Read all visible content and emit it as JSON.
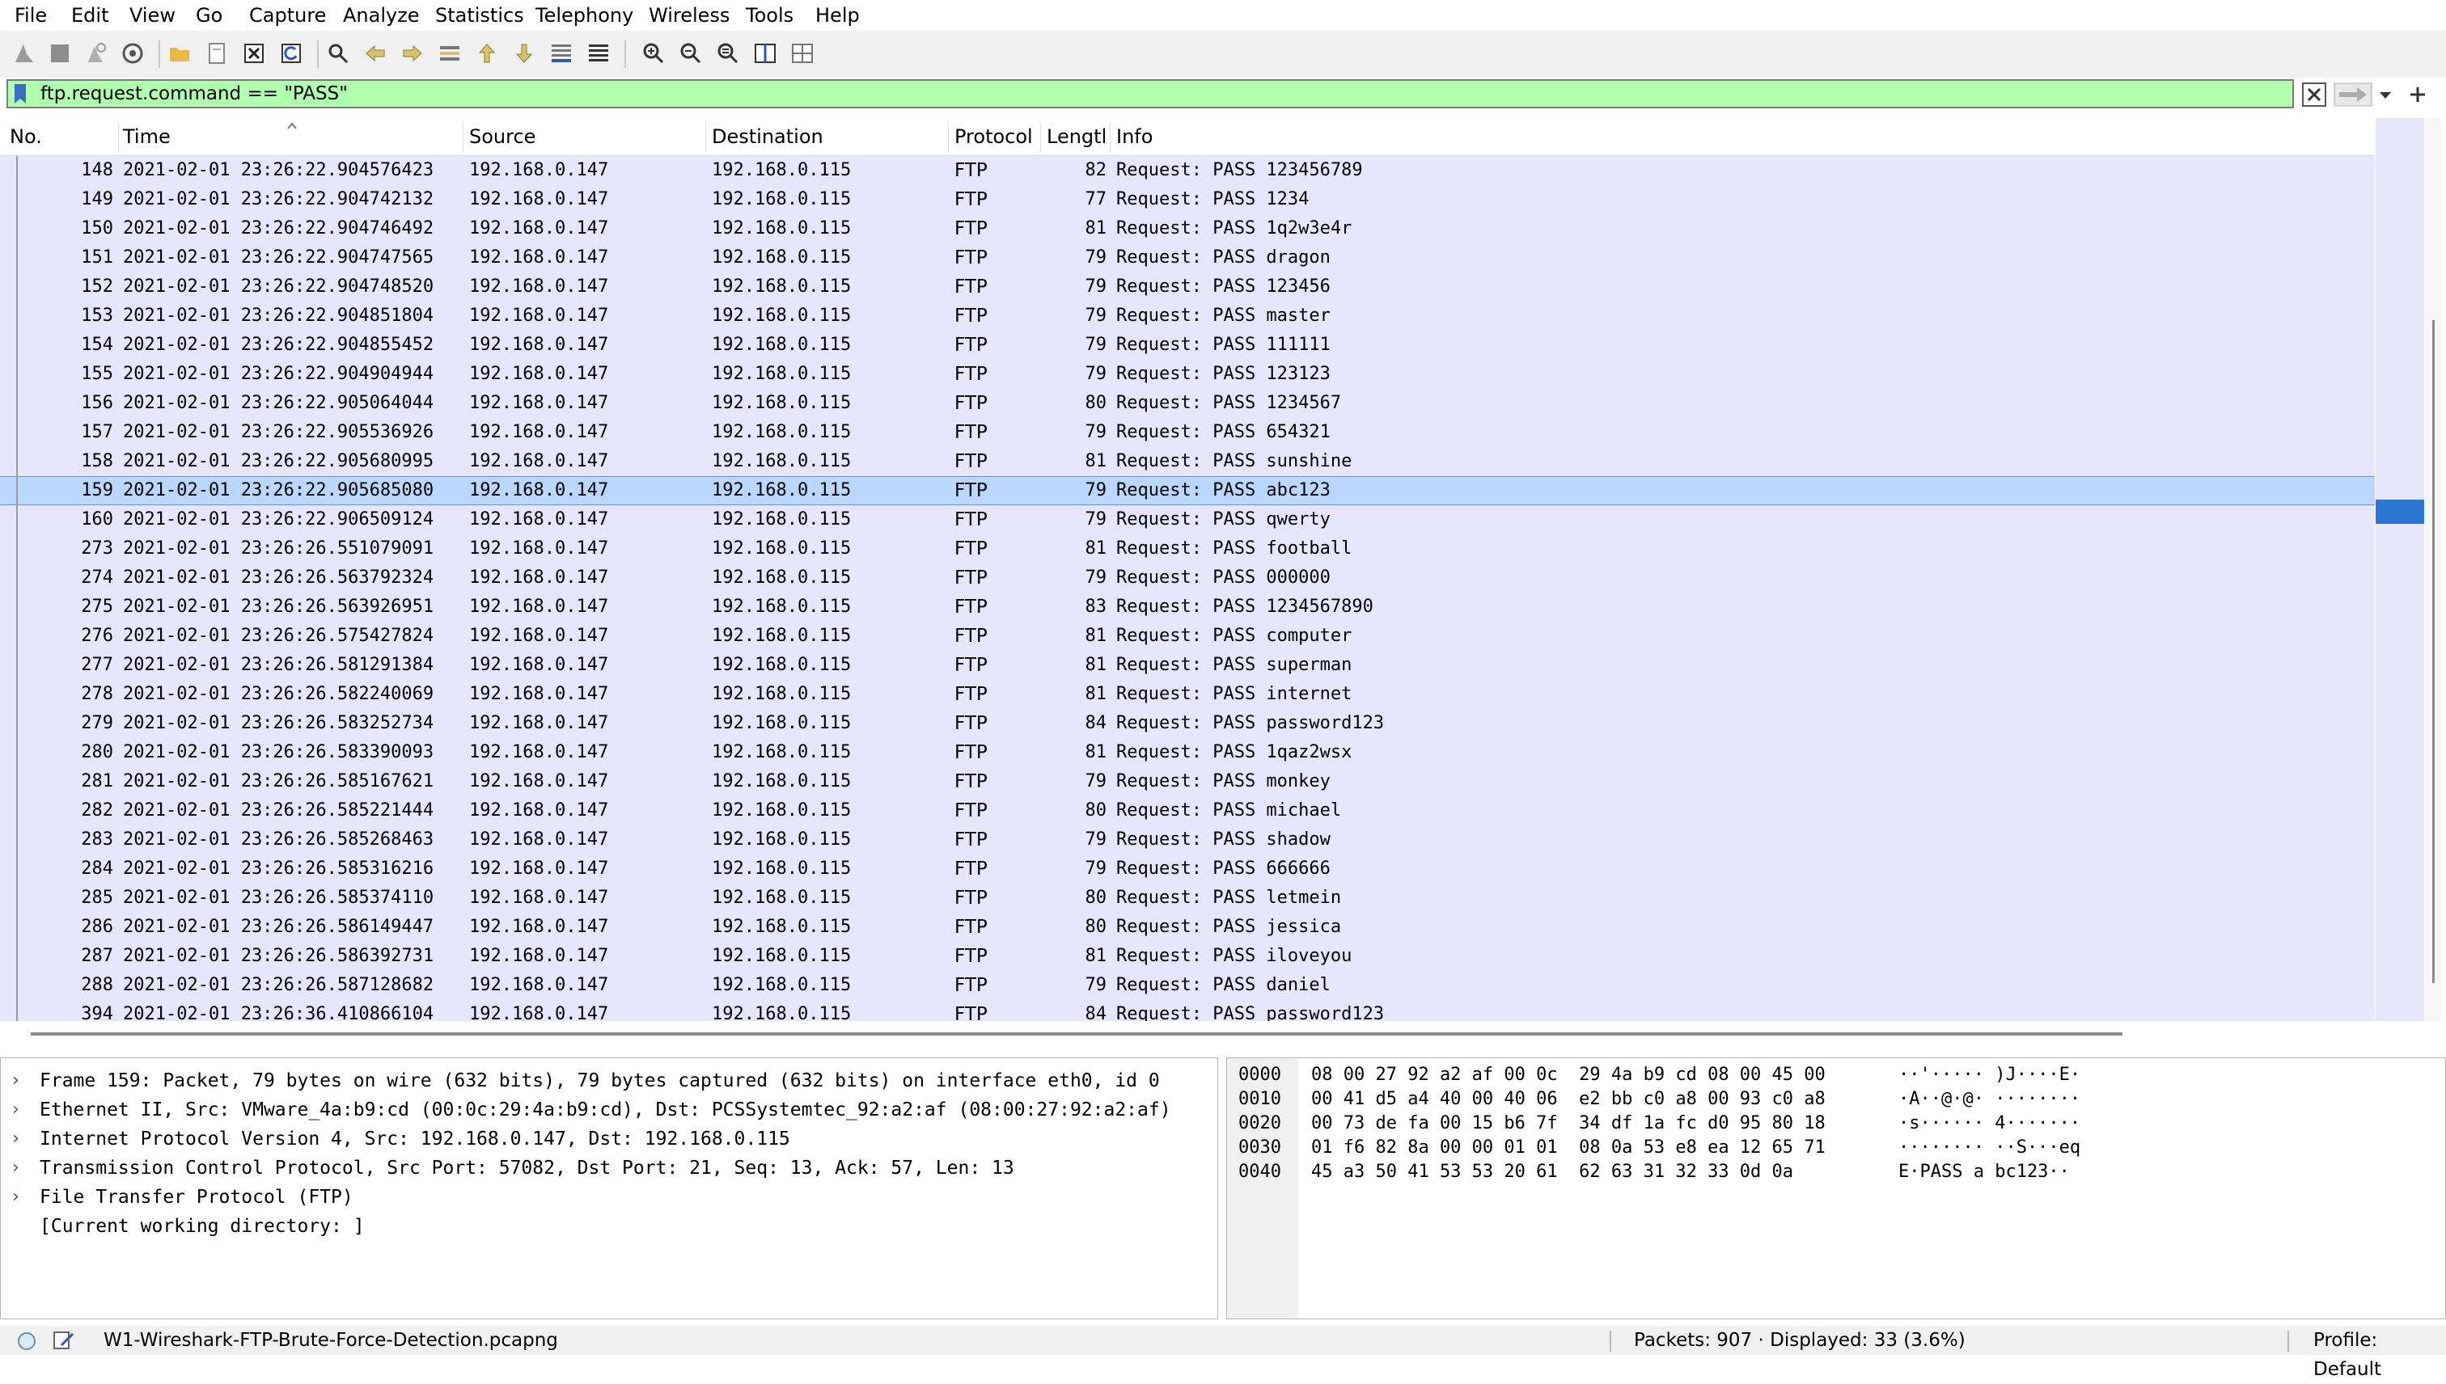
{
  "menu": [
    "File",
    "Edit",
    "View",
    "Go",
    "Capture",
    "Analyze",
    "Statistics",
    "Telephony",
    "Wireless",
    "Tools",
    "Help"
  ],
  "toolbar_icons": [
    "shark-fin-start-icon",
    "stop-capture-icon",
    "restart-capture-icon",
    "capture-options-icon",
    "open-file-icon",
    "save-file-icon",
    "close-file-icon",
    "reload-file-icon",
    "find-packet-icon",
    "go-back-icon",
    "go-forward-icon",
    "go-to-packet-icon",
    "go-first-icon",
    "go-last-icon",
    "auto-scroll-icon",
    "colorize-icon",
    "zoom-in-icon",
    "zoom-out-icon",
    "normal-size-icon",
    "resize-columns-icon",
    "layout-icon"
  ],
  "filter": {
    "value": "ftp.request.command == \"PASS\""
  },
  "columns": [
    "No.",
    "Time",
    "Source",
    "Destination",
    "Protocol",
    "Lengtl",
    "Info"
  ],
  "packets": [
    {
      "no": "148",
      "time": "2021-02-01 23:26:22.904576423",
      "src": "192.168.0.147",
      "dst": "192.168.0.115",
      "proto": "FTP",
      "len": "82",
      "info": "Request: PASS 123456789"
    },
    {
      "no": "149",
      "time": "2021-02-01 23:26:22.904742132",
      "src": "192.168.0.147",
      "dst": "192.168.0.115",
      "proto": "FTP",
      "len": "77",
      "info": "Request: PASS 1234"
    },
    {
      "no": "150",
      "time": "2021-02-01 23:26:22.904746492",
      "src": "192.168.0.147",
      "dst": "192.168.0.115",
      "proto": "FTP",
      "len": "81",
      "info": "Request: PASS 1q2w3e4r"
    },
    {
      "no": "151",
      "time": "2021-02-01 23:26:22.904747565",
      "src": "192.168.0.147",
      "dst": "192.168.0.115",
      "proto": "FTP",
      "len": "79",
      "info": "Request: PASS dragon"
    },
    {
      "no": "152",
      "time": "2021-02-01 23:26:22.904748520",
      "src": "192.168.0.147",
      "dst": "192.168.0.115",
      "proto": "FTP",
      "len": "79",
      "info": "Request: PASS 123456"
    },
    {
      "no": "153",
      "time": "2021-02-01 23:26:22.904851804",
      "src": "192.168.0.147",
      "dst": "192.168.0.115",
      "proto": "FTP",
      "len": "79",
      "info": "Request: PASS master"
    },
    {
      "no": "154",
      "time": "2021-02-01 23:26:22.904855452",
      "src": "192.168.0.147",
      "dst": "192.168.0.115",
      "proto": "FTP",
      "len": "79",
      "info": "Request: PASS 111111"
    },
    {
      "no": "155",
      "time": "2021-02-01 23:26:22.904904944",
      "src": "192.168.0.147",
      "dst": "192.168.0.115",
      "proto": "FTP",
      "len": "79",
      "info": "Request: PASS 123123"
    },
    {
      "no": "156",
      "time": "2021-02-01 23:26:22.905064044",
      "src": "192.168.0.147",
      "dst": "192.168.0.115",
      "proto": "FTP",
      "len": "80",
      "info": "Request: PASS 1234567"
    },
    {
      "no": "157",
      "time": "2021-02-01 23:26:22.905536926",
      "src": "192.168.0.147",
      "dst": "192.168.0.115",
      "proto": "FTP",
      "len": "79",
      "info": "Request: PASS 654321"
    },
    {
      "no": "158",
      "time": "2021-02-01 23:26:22.905680995",
      "src": "192.168.0.147",
      "dst": "192.168.0.115",
      "proto": "FTP",
      "len": "81",
      "info": "Request: PASS sunshine"
    },
    {
      "no": "159",
      "time": "2021-02-01 23:26:22.905685080",
      "src": "192.168.0.147",
      "dst": "192.168.0.115",
      "proto": "FTP",
      "len": "79",
      "info": "Request: PASS abc123",
      "selected": true
    },
    {
      "no": "160",
      "time": "2021-02-01 23:26:22.906509124",
      "src": "192.168.0.147",
      "dst": "192.168.0.115",
      "proto": "FTP",
      "len": "79",
      "info": "Request: PASS qwerty"
    },
    {
      "no": "273",
      "time": "2021-02-01 23:26:26.551079091",
      "src": "192.168.0.147",
      "dst": "192.168.0.115",
      "proto": "FTP",
      "len": "81",
      "info": "Request: PASS football"
    },
    {
      "no": "274",
      "time": "2021-02-01 23:26:26.563792324",
      "src": "192.168.0.147",
      "dst": "192.168.0.115",
      "proto": "FTP",
      "len": "79",
      "info": "Request: PASS 000000"
    },
    {
      "no": "275",
      "time": "2021-02-01 23:26:26.563926951",
      "src": "192.168.0.147",
      "dst": "192.168.0.115",
      "proto": "FTP",
      "len": "83",
      "info": "Request: PASS 1234567890"
    },
    {
      "no": "276",
      "time": "2021-02-01 23:26:26.575427824",
      "src": "192.168.0.147",
      "dst": "192.168.0.115",
      "proto": "FTP",
      "len": "81",
      "info": "Request: PASS computer"
    },
    {
      "no": "277",
      "time": "2021-02-01 23:26:26.581291384",
      "src": "192.168.0.147",
      "dst": "192.168.0.115",
      "proto": "FTP",
      "len": "81",
      "info": "Request: PASS superman"
    },
    {
      "no": "278",
      "time": "2021-02-01 23:26:26.582240069",
      "src": "192.168.0.147",
      "dst": "192.168.0.115",
      "proto": "FTP",
      "len": "81",
      "info": "Request: PASS internet"
    },
    {
      "no": "279",
      "time": "2021-02-01 23:26:26.583252734",
      "src": "192.168.0.147",
      "dst": "192.168.0.115",
      "proto": "FTP",
      "len": "84",
      "info": "Request: PASS password123"
    },
    {
      "no": "280",
      "time": "2021-02-01 23:26:26.583390093",
      "src": "192.168.0.147",
      "dst": "192.168.0.115",
      "proto": "FTP",
      "len": "81",
      "info": "Request: PASS 1qaz2wsx"
    },
    {
      "no": "281",
      "time": "2021-02-01 23:26:26.585167621",
      "src": "192.168.0.147",
      "dst": "192.168.0.115",
      "proto": "FTP",
      "len": "79",
      "info": "Request: PASS monkey"
    },
    {
      "no": "282",
      "time": "2021-02-01 23:26:26.585221444",
      "src": "192.168.0.147",
      "dst": "192.168.0.115",
      "proto": "FTP",
      "len": "80",
      "info": "Request: PASS michael"
    },
    {
      "no": "283",
      "time": "2021-02-01 23:26:26.585268463",
      "src": "192.168.0.147",
      "dst": "192.168.0.115",
      "proto": "FTP",
      "len": "79",
      "info": "Request: PASS shadow"
    },
    {
      "no": "284",
      "time": "2021-02-01 23:26:26.585316216",
      "src": "192.168.0.147",
      "dst": "192.168.0.115",
      "proto": "FTP",
      "len": "79",
      "info": "Request: PASS 666666"
    },
    {
      "no": "285",
      "time": "2021-02-01 23:26:26.585374110",
      "src": "192.168.0.147",
      "dst": "192.168.0.115",
      "proto": "FTP",
      "len": "80",
      "info": "Request: PASS letmein"
    },
    {
      "no": "286",
      "time": "2021-02-01 23:26:26.586149447",
      "src": "192.168.0.147",
      "dst": "192.168.0.115",
      "proto": "FTP",
      "len": "80",
      "info": "Request: PASS jessica"
    },
    {
      "no": "287",
      "time": "2021-02-01 23:26:26.586392731",
      "src": "192.168.0.147",
      "dst": "192.168.0.115",
      "proto": "FTP",
      "len": "81",
      "info": "Request: PASS iloveyou"
    },
    {
      "no": "288",
      "time": "2021-02-01 23:26:26.587128682",
      "src": "192.168.0.147",
      "dst": "192.168.0.115",
      "proto": "FTP",
      "len": "79",
      "info": "Request: PASS daniel"
    },
    {
      "no": "394",
      "time": "2021-02-01 23:26:36.410866104",
      "src": "192.168.0.147",
      "dst": "192.168.0.115",
      "proto": "FTP",
      "len": "84",
      "info": "Request: PASS password123"
    }
  ],
  "details": [
    {
      "expandable": true,
      "text": "Frame 159: Packet, 79 bytes on wire (632 bits), 79 bytes captured (632 bits) on interface eth0, id 0"
    },
    {
      "expandable": true,
      "text": "Ethernet II, Src: VMware_4a:b9:cd (00:0c:29:4a:b9:cd), Dst: PCSSystemtec_92:a2:af (08:00:27:92:a2:af)"
    },
    {
      "expandable": true,
      "text": "Internet Protocol Version 4, Src: 192.168.0.147, Dst: 192.168.0.115"
    },
    {
      "expandable": true,
      "text": "Transmission Control Protocol, Src Port: 57082, Dst Port: 21, Seq: 13, Ack: 57, Len: 13"
    },
    {
      "expandable": true,
      "text": "File Transfer Protocol (FTP)"
    },
    {
      "expandable": false,
      "text": "[Current working directory: ]"
    }
  ],
  "hex": [
    {
      "offset": "0000",
      "bytes": "08 00 27 92 a2 af 00 0c  29 4a b9 cd 08 00 45 00",
      "ascii": "··'····· )J····E·"
    },
    {
      "offset": "0010",
      "bytes": "00 41 d5 a4 40 00 40 06  e2 bb c0 a8 00 93 c0 a8",
      "ascii": "·A··@·@· ········"
    },
    {
      "offset": "0020",
      "bytes": "00 73 de fa 00 15 b6 7f  34 df 1a fc d0 95 80 18",
      "ascii": "·s······ 4·······"
    },
    {
      "offset": "0030",
      "bytes": "01 f6 82 8a 00 00 01 01  08 0a 53 e8 ea 12 65 71",
      "ascii": "········ ··S···eq"
    },
    {
      "offset": "0040",
      "bytes": "45 a3 50 41 53 53 20 61  62 63 31 32 33 0d 0a",
      "ascii": "E·PASS a bc123··"
    }
  ],
  "status": {
    "file": "W1-Wireshark-FTP-Brute-Force-Detection.pcapng",
    "packets": "Packets: 907 · Displayed: 33 (3.6%)",
    "profile": "Profile: Default"
  },
  "colors": {
    "row_bg": "#e7e6ff",
    "selected_bg": "#b9d7ff",
    "filter_bg": "#afffaf",
    "minimap_marker": "#2a76d2"
  }
}
